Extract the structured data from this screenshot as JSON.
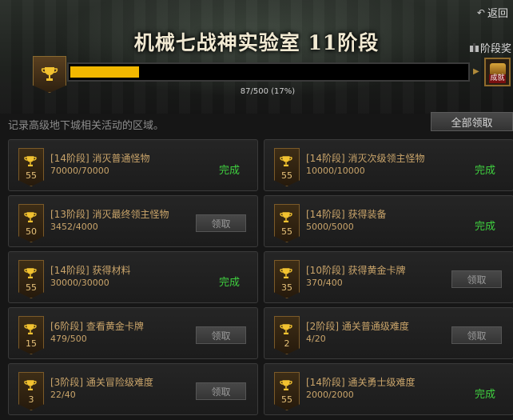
{
  "header": {
    "back_label": "返回",
    "title": "机械七战神实验室 11阶段",
    "stage_reward_label": "阶段奖"
  },
  "progress": {
    "current": 87,
    "total": 500,
    "fraction": 0.174,
    "text": "87/500 (17%)",
    "chest_label": "成就"
  },
  "description": "记录高级地下城相关活动的区域。",
  "claim_all_label": "全部领取",
  "colors": {
    "progress_fill": "#f2b800",
    "done_green": "#3fd03f",
    "gold_text": "#c9a46a"
  },
  "quests": [
    {
      "level": "55",
      "title": "[14阶段] 消灭普通怪物",
      "progress": "70000/70000",
      "status": "done",
      "action": "完成"
    },
    {
      "level": "55",
      "title": "[14阶段] 消灭次级领主怪物",
      "progress": "10000/10000",
      "status": "done",
      "action": "完成"
    },
    {
      "level": "50",
      "title": "[13阶段] 消灭最终领主怪物",
      "progress": "3452/4000",
      "status": "claim",
      "action": "领取"
    },
    {
      "level": "55",
      "title": "[14阶段] 获得装备",
      "progress": "5000/5000",
      "status": "done",
      "action": "完成"
    },
    {
      "level": "55",
      "title": "[14阶段] 获得材料",
      "progress": "30000/30000",
      "status": "done",
      "action": "完成"
    },
    {
      "level": "35",
      "title": "[10阶段] 获得黄金卡牌",
      "progress": "370/400",
      "status": "claim",
      "action": "领取"
    },
    {
      "level": "15",
      "title": "[6阶段] 查看黄金卡牌",
      "progress": "479/500",
      "status": "claim",
      "action": "领取"
    },
    {
      "level": "2",
      "title": "[2阶段] 通关普通级难度",
      "progress": "4/20",
      "status": "claim",
      "action": "领取"
    },
    {
      "level": "3",
      "title": "[3阶段] 通关冒险级难度",
      "progress": "22/40",
      "status": "claim",
      "action": "领取"
    },
    {
      "level": "55",
      "title": "[14阶段] 通关勇士级难度",
      "progress": "2000/2000",
      "status": "done",
      "action": "完成"
    }
  ]
}
